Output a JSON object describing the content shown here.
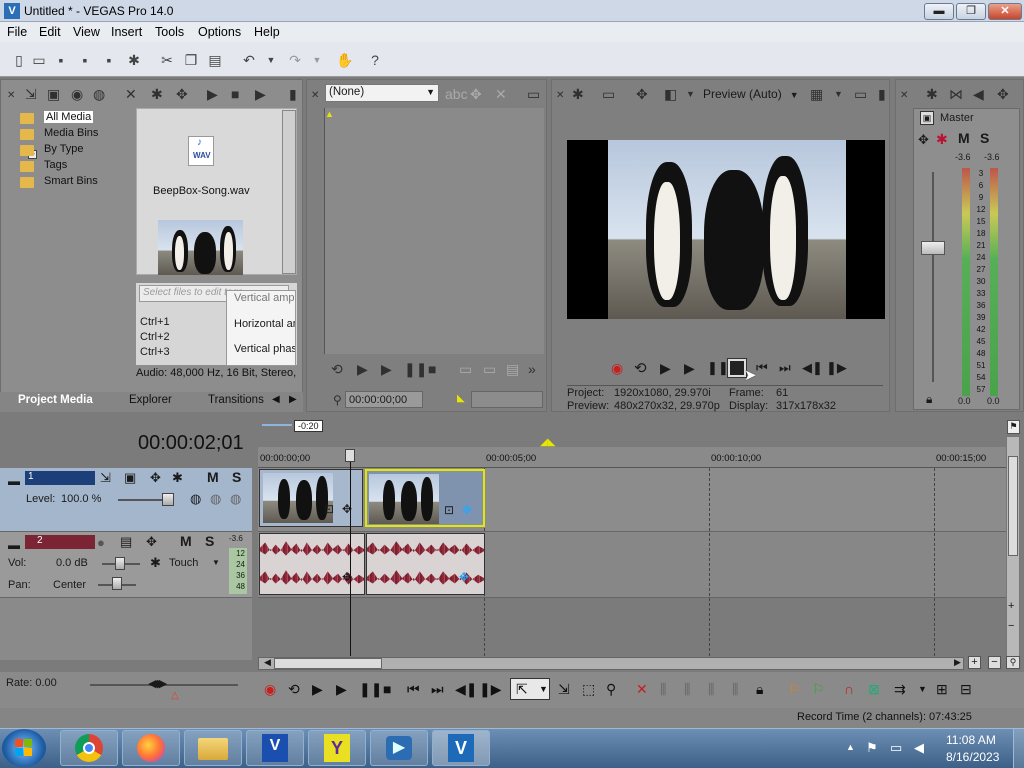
{
  "window": {
    "title": "Untitled * - VEGAS Pro 14.0",
    "app_icon": "V",
    "minimize": "▬",
    "maximize": "❐",
    "close": "✕"
  },
  "menu": [
    "File",
    "Edit",
    "View",
    "Insert",
    "Tools",
    "Options",
    "Help"
  ],
  "project_media": {
    "tree": [
      "All Media",
      "Media Bins",
      "By Type",
      "Tags",
      "Smart Bins"
    ],
    "expander": "+",
    "audio_file": "BeepBox-Song.wav",
    "wav_label": "WAV",
    "tag_placeholder": "Select files to edit tags",
    "shortcuts": [
      "Ctrl+1",
      "Ctrl+2",
      "Ctrl+3"
    ],
    "effects": [
      "Vertical ampli",
      "Horizontal am",
      "Vertical phase"
    ],
    "info": "Audio: 48,000 Hz, 16 Bit, Stereo,",
    "tabs": [
      "Project Media",
      "Explorer",
      "Transitions"
    ]
  },
  "trimmer": {
    "dropdown": "(None)",
    "timecode": "00:00:00;00"
  },
  "preview": {
    "mode": "Preview (Auto)",
    "project_label": "Project:",
    "project_value": "1920x1080, 29.970i",
    "frame_label": "Frame:",
    "frame_value": "61",
    "preview_label": "Preview:",
    "preview_value": "480x270x32, 29.970p",
    "display_label": "Display:",
    "display_value": "317x178x32"
  },
  "mixer": {
    "title": "Master",
    "m": "M",
    "s": "S",
    "peak_l": "-3.6",
    "peak_r": "-3.6",
    "scale": [
      "3",
      "6",
      "9",
      "12",
      "15",
      "18",
      "21",
      "24",
      "27",
      "30",
      "33",
      "36",
      "39",
      "42",
      "45",
      "48",
      "51",
      "54",
      "57"
    ],
    "bottom_l": "0.0",
    "bottom_r": "0.0"
  },
  "timeline": {
    "timecode": "00:00:02;01",
    "loop_marker": "-0:20",
    "ruler": [
      "00:00:00;00",
      "00:00:05;00",
      "00:00:10;00",
      "00:00:15;00"
    ],
    "video_track": {
      "number": "1",
      "level_label": "Level:",
      "level_value": "100.0 %",
      "m": "M",
      "s": "S"
    },
    "audio_track": {
      "number": "2",
      "vol_label": "Vol:",
      "vol_value": "0.0 dB",
      "pan_label": "Pan:",
      "pan_value": "Center",
      "mode": "Touch",
      "m": "M",
      "s": "S",
      "peak": "-3.6",
      "scale": [
        "12",
        "24",
        "36",
        "48"
      ]
    },
    "rate_label": "Rate: 0.00",
    "record_time": "Record Time (2 channels): 07:43:25"
  },
  "taskbar": {
    "time": "11:08 AM",
    "date": "8/16/2023",
    "tray_up": "▲"
  },
  "colors": {
    "accent": "#2d6fb7",
    "record": "#c81e1e",
    "selection_outline": "#e6e600"
  }
}
